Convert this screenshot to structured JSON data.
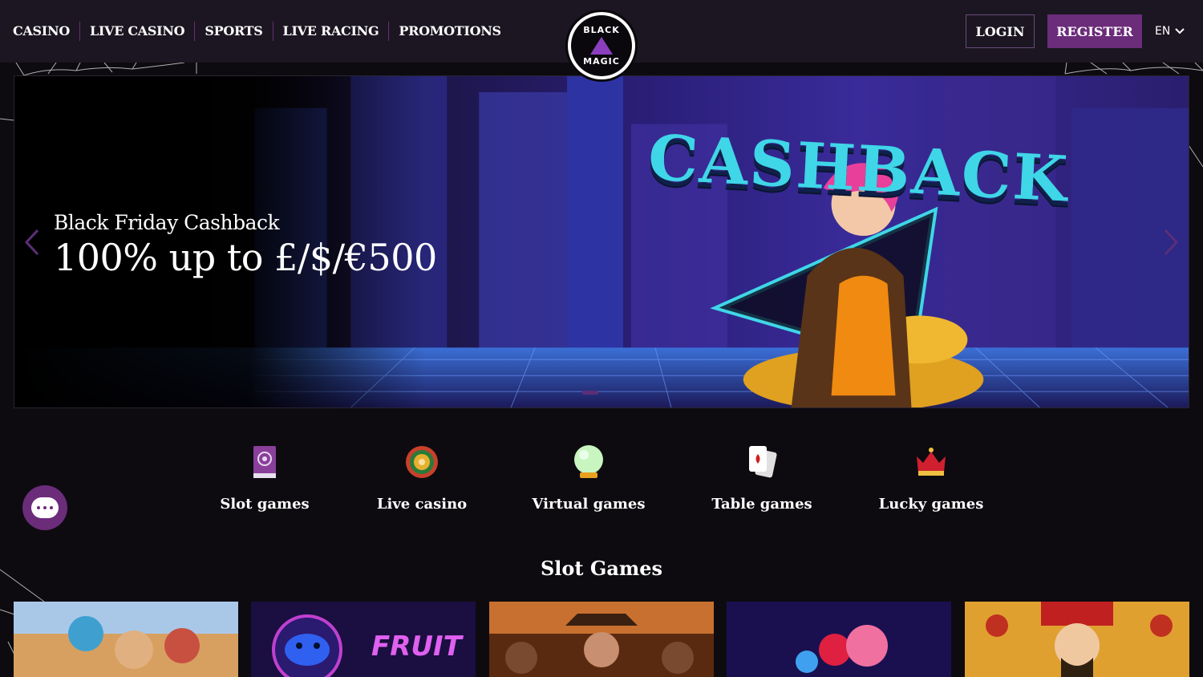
{
  "header": {
    "nav": [
      "CASINO",
      "LIVE CASINO",
      "SPORTS",
      "LIVE RACING",
      "PROMOTIONS"
    ],
    "logo": {
      "line1": "BLACK",
      "line2": "MAGIC"
    },
    "login_label": "LOGIN",
    "register_label": "REGISTER",
    "language": "EN",
    "language_icon": "chevron-down-icon"
  },
  "hero": {
    "subtitle": "Black Friday Cashback",
    "title": "100% up to £/$/€500",
    "banner_word": "CASHBACK",
    "prev_icon": "chevron-left-icon",
    "next_icon": "chevron-right-icon"
  },
  "categories": [
    {
      "label": "Slot games",
      "icon": "spellbook-icon"
    },
    {
      "label": "Live casino",
      "icon": "roulette-icon"
    },
    {
      "label": "Virtual games",
      "icon": "crystal-ball-icon"
    },
    {
      "label": "Table games",
      "icon": "playing-cards-icon"
    },
    {
      "label": "Lucky games",
      "icon": "crown-icon"
    }
  ],
  "section": {
    "title": "Slot Games"
  },
  "games": [
    {
      "name": "game-tile-1"
    },
    {
      "name": "game-tile-2",
      "text": "FRUIT"
    },
    {
      "name": "game-tile-3"
    },
    {
      "name": "game-tile-4"
    },
    {
      "name": "game-tile-5"
    }
  ],
  "colors": {
    "header_bg": "#1b1621",
    "accent": "#6b2c7a",
    "page_bg": "#0d0b10",
    "cashback_text": "#3fd6e8"
  }
}
